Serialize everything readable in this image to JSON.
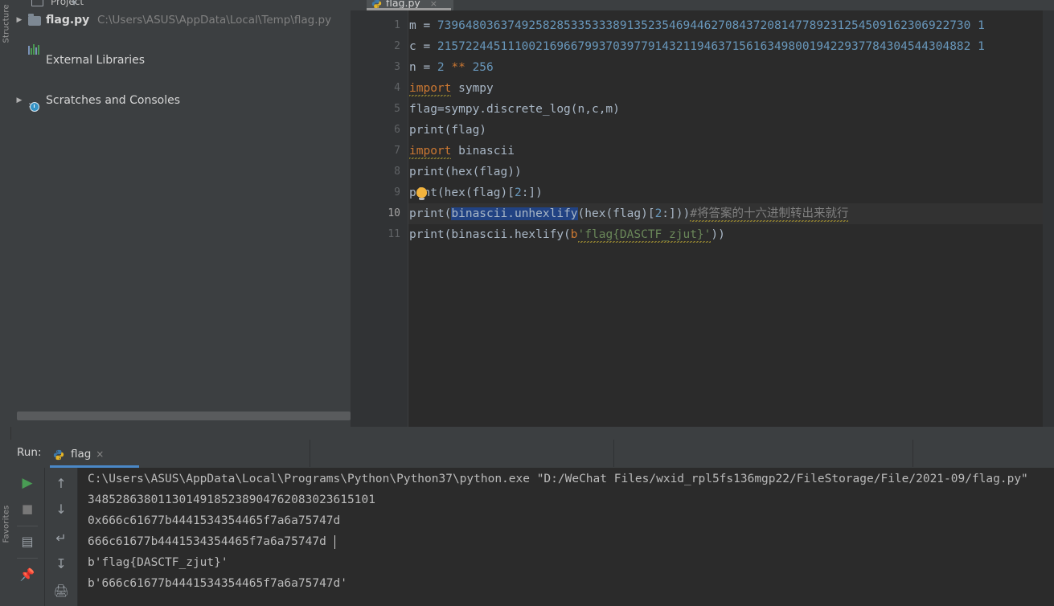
{
  "window": {
    "project_label": "Project",
    "ide": "PyCharm"
  },
  "toolbar": {
    "anchor_icon": "anchor-icon",
    "collapse_icon": "collapse-all-icon",
    "gear_icon": "gear-icon"
  },
  "project_tree": {
    "items": [
      {
        "label": "flag.py",
        "path": "C:\\Users\\ASUS\\AppData\\Local\\Temp\\flag.py",
        "icon": "folder-icon",
        "expandable": true
      },
      {
        "label": "External Libraries",
        "path": "",
        "icon": "libraries-icon",
        "expandable": false
      },
      {
        "label": "Scratches and Consoles",
        "path": "",
        "icon": "scratches-icon",
        "expandable": true
      }
    ]
  },
  "left_strip": {
    "tabs": [
      "Structure",
      "Favorites"
    ]
  },
  "editor": {
    "tab": {
      "label": "flag.py",
      "icon": "python-file-icon",
      "close": "×"
    },
    "lines": [
      {
        "n": "1",
        "active": false
      },
      {
        "n": "2",
        "active": false
      },
      {
        "n": "3",
        "active": false
      },
      {
        "n": "4",
        "active": false
      },
      {
        "n": "5",
        "active": false
      },
      {
        "n": "6",
        "active": false
      },
      {
        "n": "7",
        "active": false
      },
      {
        "n": "8",
        "active": false
      },
      {
        "n": "9",
        "active": false
      },
      {
        "n": "10",
        "active": true
      },
      {
        "n": "11",
        "active": false
      }
    ],
    "code": {
      "l1_var": "m = ",
      "l1_num": "7396480363749258285335333891352354694462708437208147789231254509162306922730 1",
      "l2_var": "c = ",
      "l2_num": "2157224451110021696679937039779143211946371561634980019422937784304544304882 1",
      "l3_var": "n = ",
      "l3_num": "2",
      "l3_op": " ** ",
      "l3_num2": "256",
      "l4_kw": "import",
      "l4_rest": " sympy",
      "l5": "flag=sympy.discrete_log(n,c,m)",
      "l6": "print(flag)",
      "l7_kw": "import",
      "l7_rest": " binascii",
      "l8": "print(hex(flag))",
      "l9_a": "p",
      "l9_b": "int(hex(flag)[",
      "l9_num": "2",
      "l9_c": ":])",
      "l10_a": "print(",
      "l10_sel": "binascii.unhexlify",
      "l10_b": "(hex(flag)[",
      "l10_num": "2",
      "l10_c": ":]))",
      "l10_comment": "#将答案的十六进制转出来就行",
      "l11_a": "print(binascii.hexlify(",
      "l11_b": "b",
      "l11_str": "'flag{DASCTF_zjut}'",
      "l11_c": "))"
    }
  },
  "run_panel": {
    "label": "Run:",
    "tab": {
      "label": "flag",
      "icon": "python-run-icon",
      "close": "×"
    },
    "toolbar": [
      {
        "name": "run-button",
        "glyph": "▶"
      },
      {
        "name": "stop-button",
        "glyph": "■"
      },
      {
        "name": "layout-settings-button",
        "glyph": "▤"
      },
      {
        "name": "pin-tab-button",
        "glyph": "📌"
      },
      {
        "name": "scroll-up-button",
        "glyph": "↑"
      },
      {
        "name": "scroll-down-button",
        "glyph": "↓"
      },
      {
        "name": "soft-wrap-button",
        "glyph": "↵"
      },
      {
        "name": "scroll-to-end-button",
        "glyph": "↧"
      },
      {
        "name": "print-button",
        "glyph": "🖨"
      }
    ],
    "output": [
      "C:\\Users\\ASUS\\AppData\\Local\\Programs\\Python\\Python37\\python.exe \"D:/WeChat Files/wxid_rpl5fs136mgp22/FileStorage/File/2021-09/flag.py\"",
      "34852863801130149185238904762083023615101",
      "0x666c61677b4441534354465f7a6a75747d",
      "666c61677b4441534354465f7a6a75747d",
      "b'flag{DASCTF_zjut}'",
      "b'666c61677b4441534354465f7a6a75747d'"
    ]
  },
  "colors": {
    "editor_bg": "#2b2b2b",
    "panel_bg": "#3c3f41",
    "gutter_bg": "#313335",
    "keyword": "#cc7832",
    "number": "#6897bb",
    "string": "#6a8759",
    "comment": "#808080",
    "selection": "#214283",
    "accent": "#4a88c7",
    "run_green": "#499c54"
  }
}
